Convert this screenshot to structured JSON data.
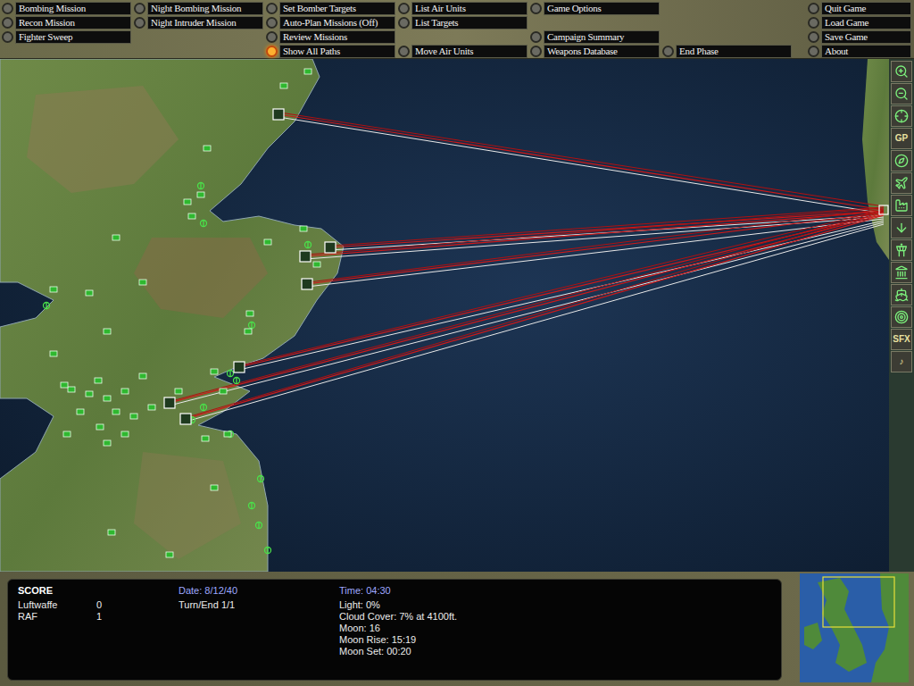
{
  "menu": {
    "columns": [
      [
        {
          "kind": "button",
          "label": "Bombing Mission",
          "selected": false
        },
        {
          "kind": "button",
          "label": "Recon Mission",
          "selected": false
        },
        {
          "kind": "button",
          "label": "Fighter Sweep",
          "selected": false
        },
        {
          "kind": "empty",
          "label": "",
          "selected": false
        }
      ],
      [
        {
          "kind": "button",
          "label": "Night Bombing Mission",
          "selected": false
        },
        {
          "kind": "button",
          "label": "Night Intruder Mission",
          "selected": false
        },
        {
          "kind": "empty",
          "label": "",
          "selected": false
        },
        {
          "kind": "empty",
          "label": "",
          "selected": false
        }
      ],
      [
        {
          "kind": "button",
          "label": "Set Bomber Targets",
          "selected": false
        },
        {
          "kind": "button",
          "label": "Auto-Plan Missions (Off)",
          "selected": false
        },
        {
          "kind": "button",
          "label": "Review Missions",
          "selected": false
        },
        {
          "kind": "button",
          "label": "Show All Paths",
          "selected": true
        }
      ],
      [
        {
          "kind": "button",
          "label": "List Air Units",
          "selected": false
        },
        {
          "kind": "button",
          "label": "List Targets",
          "selected": false
        },
        {
          "kind": "empty",
          "label": "",
          "selected": false
        },
        {
          "kind": "button",
          "label": "Move Air Units",
          "selected": false
        }
      ],
      [
        {
          "kind": "button",
          "label": "Game Options",
          "selected": false
        },
        {
          "kind": "empty",
          "label": "",
          "selected": false
        },
        {
          "kind": "button",
          "label": "Campaign Summary",
          "selected": false
        },
        {
          "kind": "button",
          "label": "Weapons Database",
          "selected": false
        }
      ],
      [
        {
          "kind": "empty",
          "label": "",
          "selected": false
        },
        {
          "kind": "empty",
          "label": "",
          "selected": false
        },
        {
          "kind": "empty",
          "label": "",
          "selected": false
        },
        {
          "kind": "button",
          "label": "End Phase",
          "selected": false
        }
      ]
    ],
    "system": [
      {
        "kind": "button",
        "label": "Quit Game",
        "selected": false
      },
      {
        "kind": "button",
        "label": "Load Game",
        "selected": false
      },
      {
        "kind": "button",
        "label": "Save Game",
        "selected": false
      },
      {
        "kind": "button",
        "label": "About",
        "selected": false
      }
    ]
  },
  "toolbar": [
    {
      "kind": "icon",
      "label": ""
    },
    {
      "kind": "icon",
      "label": ""
    },
    {
      "kind": "icon",
      "label": ""
    },
    {
      "kind": "text",
      "label": "GP"
    },
    {
      "kind": "icon",
      "label": ""
    },
    {
      "kind": "icon",
      "label": ""
    },
    {
      "kind": "icon",
      "label": ""
    },
    {
      "kind": "icon",
      "label": ""
    },
    {
      "kind": "icon",
      "label": ""
    },
    {
      "kind": "icon",
      "label": ""
    },
    {
      "kind": "icon",
      "label": ""
    },
    {
      "kind": "icon",
      "label": ""
    },
    {
      "kind": "text",
      "label": "SFX"
    },
    {
      "kind": "text",
      "label": "♪"
    }
  ],
  "status": {
    "score": {
      "title": "SCORE",
      "rows": [
        {
          "side": "Luftwaffe",
          "value": "0"
        },
        {
          "side": "RAF",
          "value": "1"
        }
      ]
    },
    "date": "Date: 8/12/40",
    "turn": "Turn/End 1/1",
    "time": "Time: 04:30",
    "conditions": [
      "Light: 0%",
      "Cloud Cover: 7% at 4100ft.",
      "Moon: 16",
      "Moon Rise: 15:19",
      "Moon Set: 00:20"
    ]
  }
}
